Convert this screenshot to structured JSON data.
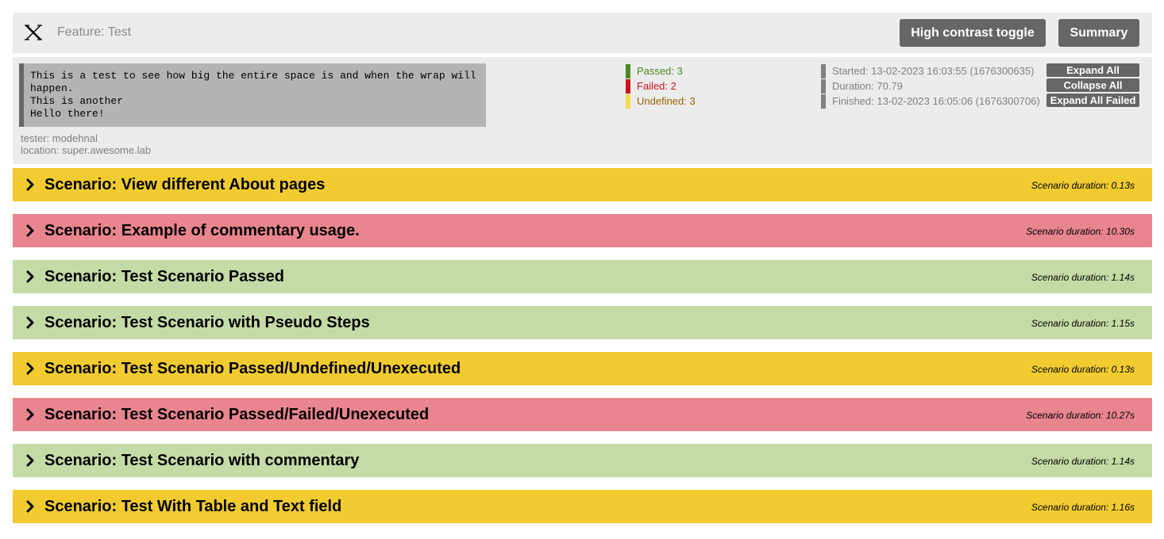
{
  "header": {
    "feature_title": "Feature: Test",
    "logo_icon": "x-logo-icon",
    "contrast_button": "High contrast toggle",
    "summary_button": "Summary"
  },
  "info": {
    "description_lines": [
      "This is a test to see how big the entire space is and when the wrap will happen.",
      "This is another",
      "Hello there!"
    ],
    "tester": "tester: modehnal",
    "location": "location: super.awesome.lab",
    "stats": {
      "passed": "Passed: 3",
      "failed": "Failed: 2",
      "undefined": "Undefined: 3"
    },
    "times": {
      "started": "Started: 13-02-2023 16:03:55 (1676300635)",
      "duration": "Duration: 70.79",
      "finished": "Finished: 13-02-2023 16:05:06 (1676300706)"
    },
    "actions": {
      "expand_all": "Expand All",
      "collapse_all": "Collapse All",
      "expand_all_failed": "Expand All Failed"
    }
  },
  "colors": {
    "undefined": "#f1cb30",
    "failed": "#e9858e",
    "passed": "#c4dba6"
  },
  "scenarios": [
    {
      "title": "Scenario: View different About pages",
      "duration": "Scenario duration: 0.13s",
      "status": "undefined"
    },
    {
      "title": "Scenario: Example of commentary usage.",
      "duration": "Scenario duration: 10.30s",
      "status": "failed"
    },
    {
      "title": "Scenario: Test Scenario Passed",
      "duration": "Scenario duration: 1.14s",
      "status": "passed"
    },
    {
      "title": "Scenario: Test Scenario with Pseudo Steps",
      "duration": "Scenario duration: 1.15s",
      "status": "passed"
    },
    {
      "title": "Scenario: Test Scenario Passed/Undefined/Unexecuted",
      "duration": "Scenario duration: 0.13s",
      "status": "undefined"
    },
    {
      "title": "Scenario: Test Scenario Passed/Failed/Unexecuted",
      "duration": "Scenario duration: 10.27s",
      "status": "failed"
    },
    {
      "title": "Scenario: Test Scenario with commentary",
      "duration": "Scenario duration: 1.14s",
      "status": "passed"
    },
    {
      "title": "Scenario: Test With Table and Text field",
      "duration": "Scenario duration: 1.16s",
      "status": "undefined"
    }
  ]
}
